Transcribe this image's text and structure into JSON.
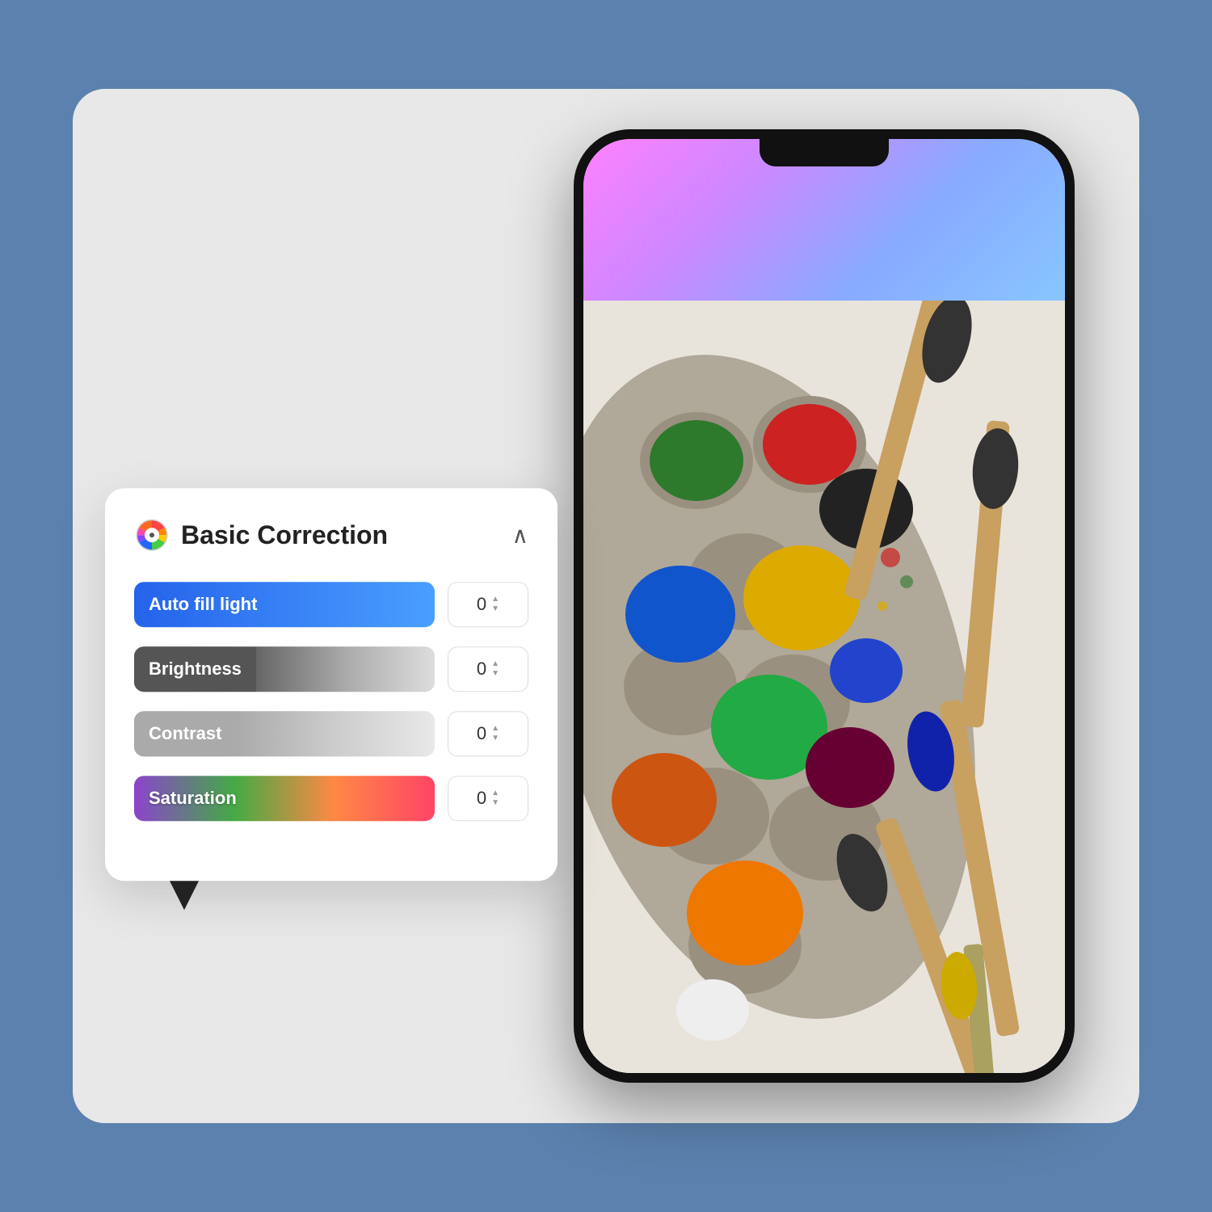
{
  "background_color": "#5b82ae",
  "card": {
    "background": "#e8e8e8",
    "border_radius": "40px"
  },
  "panel": {
    "title": "Basic Correction",
    "icon": "color-wheel",
    "chevron": "∧",
    "controls": [
      {
        "id": "auto-fill-light",
        "label": "Auto fill light",
        "value": "0",
        "type": "auto-fill"
      },
      {
        "id": "brightness",
        "label": "Brightness",
        "value": "0",
        "type": "brightness"
      },
      {
        "id": "contrast",
        "label": "Contrast",
        "value": "0",
        "type": "contrast"
      },
      {
        "id": "saturation",
        "label": "Saturation",
        "value": "0",
        "type": "saturation"
      }
    ]
  },
  "phone": {
    "top_gradient_colors": [
      "#ff80ff",
      "#cc88ff",
      "#88ccff"
    ],
    "image_description": "Paint palette with colorful paint pots and brushes"
  }
}
